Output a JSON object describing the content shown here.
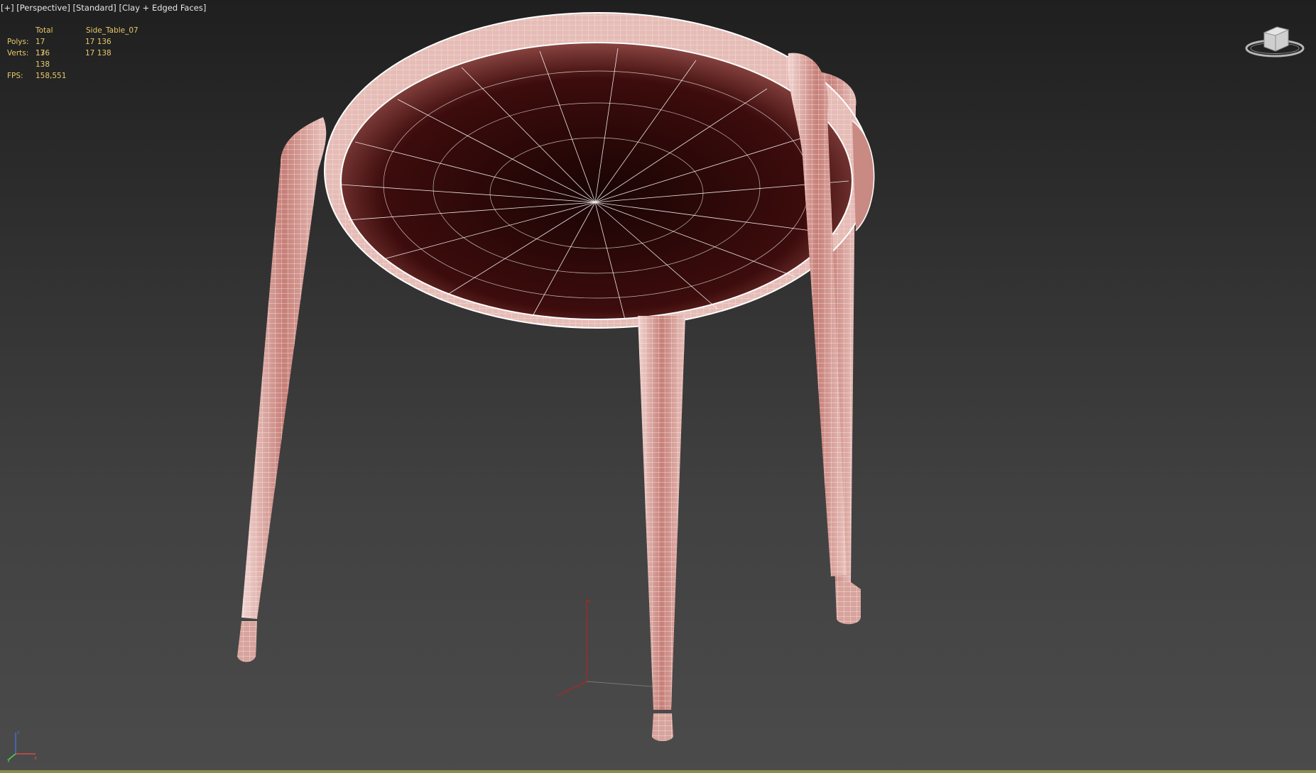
{
  "viewport": {
    "label_parts": [
      "[+]",
      "[Perspective]",
      "[Standard]",
      "[Clay + Edged Faces]"
    ]
  },
  "stats": {
    "header_total": "Total",
    "header_object": "Side_Table_07",
    "polys_label": "Polys:",
    "polys_total": "17 136",
    "polys_object": "17 136",
    "verts_label": "Verts:",
    "verts_total": "17 138",
    "verts_object": "17 138",
    "fps_label": "FPS:",
    "fps_value": "158,551"
  },
  "colors": {
    "stats_text": "#e8c96a",
    "wire": "#ffffff",
    "surface": "#c77f78",
    "surface_dark": "#3d0c0c",
    "grid_red": "#c02020"
  },
  "icons": {
    "viewcube": "viewcube-icon",
    "axis_tripod": "axis-tripod-icon",
    "world_axis": "world-axis-gizmo-icon"
  }
}
